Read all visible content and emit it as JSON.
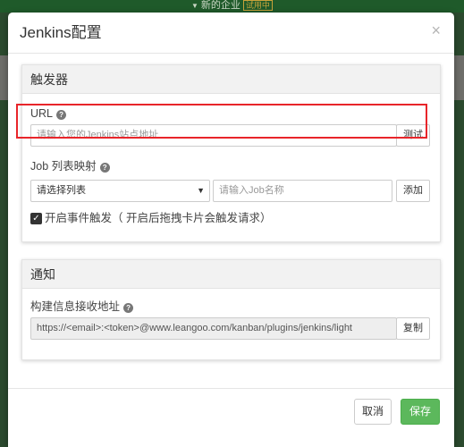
{
  "background": {
    "top_label": "新的企业",
    "trial_badge": "试用中"
  },
  "modal": {
    "title": "Jenkins配置",
    "close_symbol": "×"
  },
  "trigger_panel": {
    "heading": "触发器",
    "url_label": "URL",
    "url_placeholder": "请输入您的Jenkins站点地址",
    "test_button": "测试",
    "job_label": "Job 列表映射",
    "list_select_value": "请选择列表",
    "job_name_placeholder": "请输入Job名称",
    "add_button": "添加",
    "event_trigger_checked": true,
    "event_trigger_label": "开启事件触发（ 开启后拖拽卡片会触发请求）"
  },
  "notify_panel": {
    "heading": "通知",
    "build_url_label": "构建信息接收地址",
    "build_url_value": "https://<email>:<token>@www.leangoo.com/kanban/plugins/jenkins/light",
    "copy_button": "复制"
  },
  "footer": {
    "cancel_button": "取消",
    "save_button": "保存"
  },
  "colors": {
    "save_green": "#5cb85c",
    "highlight_red": "#e8252a",
    "backdrop_green": "#2b4a2e"
  }
}
